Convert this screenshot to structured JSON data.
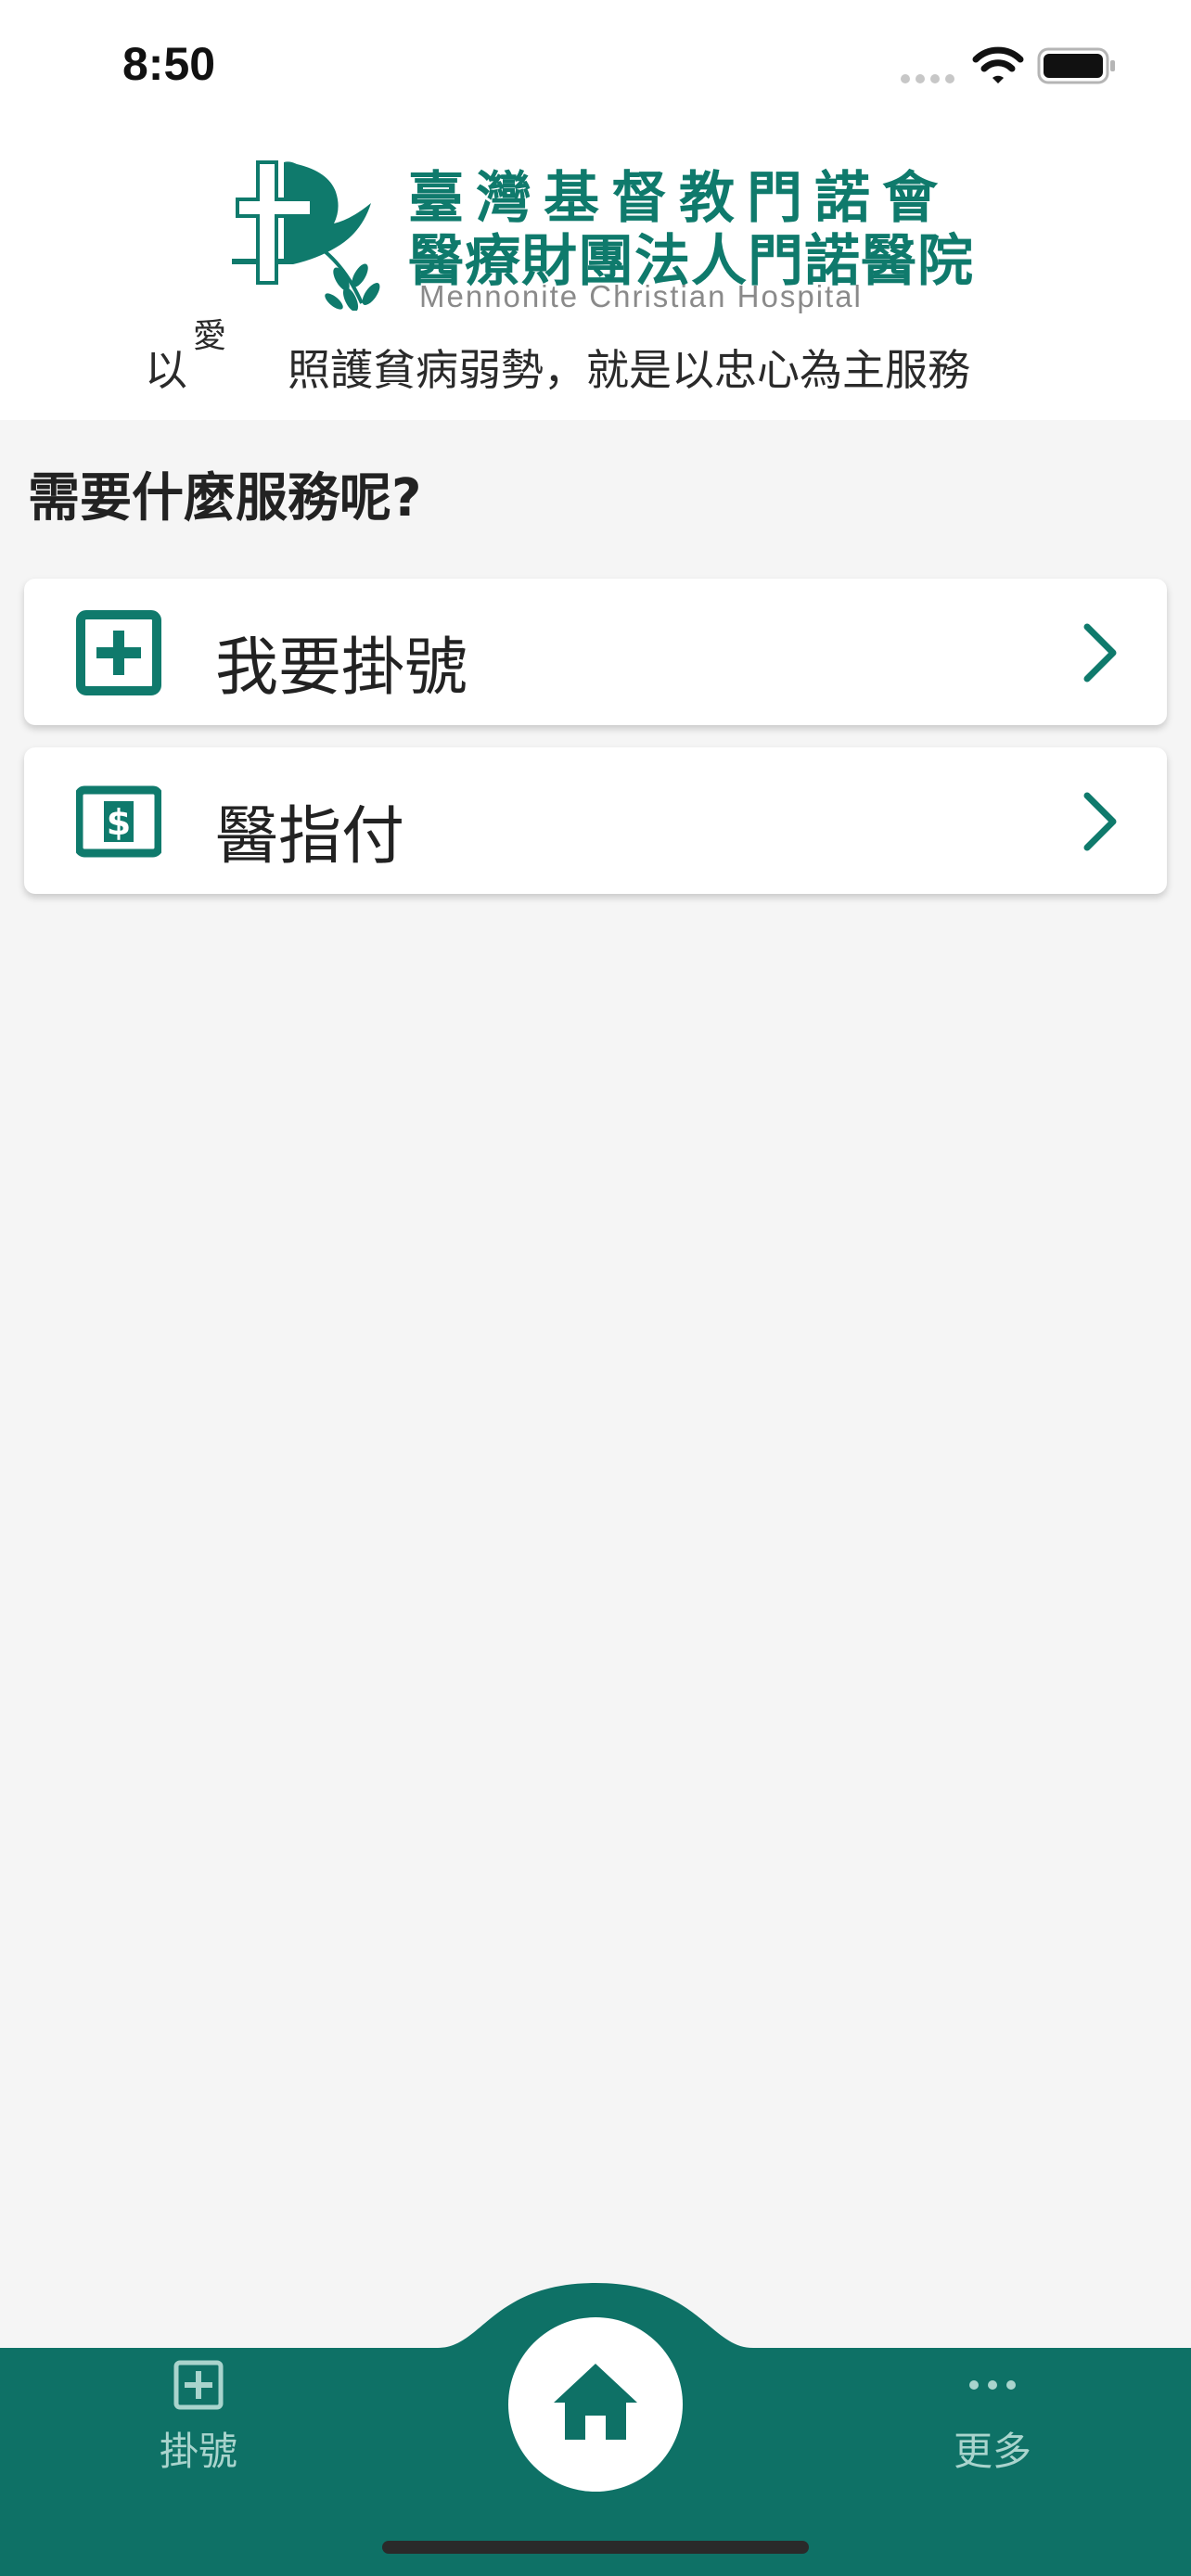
{
  "status_bar": {
    "time": "8:50"
  },
  "header": {
    "logo_line1": "臺灣基督教門諾會",
    "logo_line2": "醫療財團法人門諾醫院",
    "logo_english": "Mennonite Christian Hospital",
    "slogan_prefix": "以",
    "slogan_ruby": "愛",
    "slogan_rest": "照護貧病弱勢，就是以忠心為主服務"
  },
  "main": {
    "title": "需要什麼服務呢?",
    "services": [
      {
        "label": "我要掛號",
        "icon": "plus-square-icon"
      },
      {
        "label": "醫指付",
        "icon": "dollar-card-icon"
      }
    ]
  },
  "tab_bar": {
    "items": [
      {
        "label": "掛號",
        "icon": "plus-square-icon"
      },
      {
        "label": "",
        "icon": "home-icon"
      },
      {
        "label": "更多",
        "icon": "more-dots-icon"
      }
    ]
  },
  "colors": {
    "brand": "#0f7a6c",
    "tab_bar": "#0e7166",
    "tab_label": "#a9d4cd",
    "background": "#f5f5f5"
  }
}
